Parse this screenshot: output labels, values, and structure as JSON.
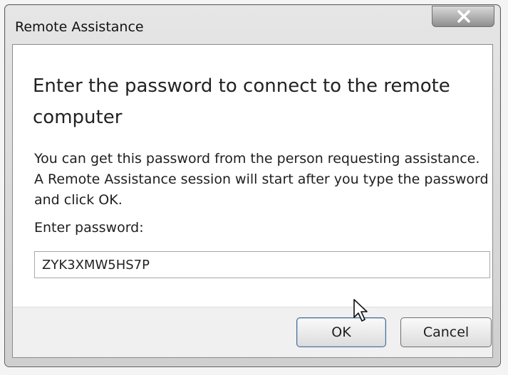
{
  "window": {
    "title": "Remote Assistance"
  },
  "dialog": {
    "heading": "Enter the password to connect to the remote computer",
    "description": "You can get this password from the person requesting assistance.  A Remote Assistance session will start after you type the password and click OK.",
    "password_label": "Enter password:",
    "password_value": "ZYK3XMW5HS7P"
  },
  "buttons": {
    "ok_label": "OK",
    "cancel_label": "Cancel"
  },
  "icons": {
    "close": "close-icon",
    "cursor": "mouse-pointer-icon"
  }
}
